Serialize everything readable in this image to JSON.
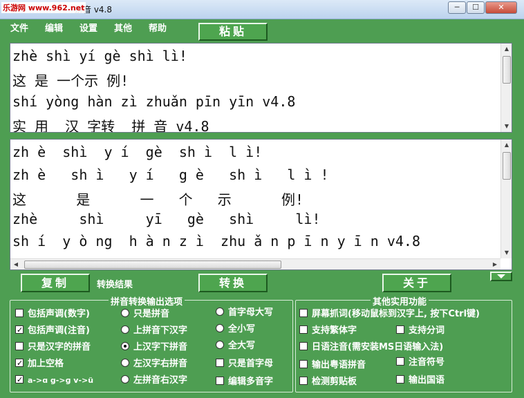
{
  "window": {
    "title": "拼音 v4.8",
    "watermark": "乐游网 www.962.net",
    "minimize": "─",
    "maximize": "☐",
    "close": "✕"
  },
  "menu": [
    "文件",
    "编辑",
    "设置",
    "其他",
    "帮助"
  ],
  "buttons": {
    "paste": "粘贴",
    "copy": "复制",
    "convert": "转换",
    "about": "关于"
  },
  "input_lines": [
    "zhè shì yí gè shì lì!",
    "这 是 一个示 例!",
    "shí yòng hàn zì zhuǎn pīn yīn v4.8",
    "实 用  汉 字转  拼 音 v4.8"
  ],
  "output_lines": [
    "zh è  shì  y í  gè  sh ì  l ì!",
    "zh è   sh ì   y í   g è   sh ì   l ì !",
    "这      是      一   个   示      例!",
    "zhè     shì     yī   gè   shì     lì!",
    "sh í  y ò ng  h à n z ì  zhu ǎ n p ī n y ī n v4.8"
  ],
  "result_label": "转换结果",
  "pinyin_group": {
    "legend": "拼音转换输出选项",
    "col1": [
      {
        "label": "包括声调(数字)",
        "checked": false
      },
      {
        "label": "包括声调(注音)",
        "checked": true
      },
      {
        "label": "只是汉字的拼音",
        "checked": false
      },
      {
        "label": "加上空格",
        "checked": true
      },
      {
        "label": "a->ɑ g->ɡ v->ü",
        "checked": true
      }
    ],
    "col2": [
      {
        "label": "只是拼音",
        "checked": false
      },
      {
        "label": "上拼音下汉字",
        "checked": false
      },
      {
        "label": "上汉字下拼音",
        "checked": true
      },
      {
        "label": "左汉字右拼音",
        "checked": false
      },
      {
        "label": "左拼音右汉字",
        "checked": false
      }
    ],
    "col3": [
      {
        "label": "首字母大写",
        "type": "radio",
        "checked": false
      },
      {
        "label": "全小写",
        "type": "radio",
        "checked": false
      },
      {
        "label": "全大写",
        "type": "radio",
        "checked": false
      },
      {
        "label": "只是首字母",
        "type": "checkbox",
        "checked": false
      },
      {
        "label": "编辑多音字",
        "type": "checkbox",
        "checked": false
      }
    ]
  },
  "other_group": {
    "legend": "其他实用功能",
    "items": [
      {
        "label": "屏幕抓词(移动鼠标到汉字上, 按下Ctrl键)",
        "checked": false
      },
      {
        "label": "支持繁体字",
        "checked": false
      },
      {
        "label": "支持分词",
        "checked": false
      },
      {
        "label": "日语注音(需安装MS日语输入法)",
        "checked": false
      },
      {
        "label": "输出粤语拼音",
        "checked": false
      },
      {
        "label": "注音符号",
        "checked": false
      },
      {
        "label": "检测剪贴板",
        "checked": false
      },
      {
        "label": "输出国语",
        "checked": false
      }
    ]
  },
  "scroll_icons": {
    "up": "▲",
    "down": "▼",
    "left": "◀",
    "right": "▶"
  }
}
